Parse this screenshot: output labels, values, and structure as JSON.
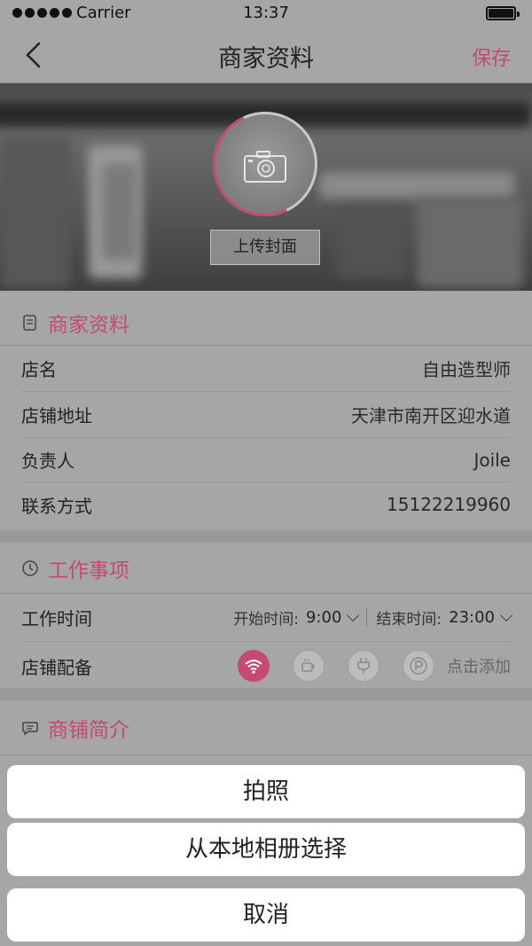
{
  "status_bar": {
    "carrier": "Carrier",
    "time": "13:37"
  },
  "nav": {
    "title": "商家资料",
    "save": "保存"
  },
  "cover": {
    "upload_label": "上传封面"
  },
  "merchant_info": {
    "title": "商家资料",
    "rows": [
      {
        "label": "店名",
        "value": "自由造型师"
      },
      {
        "label": "店铺地址",
        "value": "天津市南开区迎水道"
      },
      {
        "label": "负责人",
        "value": "Joile"
      },
      {
        "label": "联系方式",
        "value": "15122219960"
      }
    ]
  },
  "work": {
    "title": "工作事项",
    "time_label": "工作时间",
    "start_label": "开始时间:",
    "start_value": "9:00",
    "end_label": "结束时间:",
    "end_value": "23:00",
    "amenities_label": "店铺配备",
    "amenities": [
      {
        "icon": "wifi-icon",
        "active": true
      },
      {
        "icon": "coffee-icon",
        "active": false
      },
      {
        "icon": "plug-icon",
        "active": false
      },
      {
        "icon": "parking-icon",
        "active": false
      }
    ],
    "add_label": "点击添加"
  },
  "intro": {
    "title": "商铺简介"
  },
  "action_sheet": {
    "take_photo": "拍照",
    "choose_album": "从本地相册选择",
    "cancel": "取消"
  },
  "colors": {
    "accent": "#c44a72",
    "overlay": "#a6a6a6"
  }
}
